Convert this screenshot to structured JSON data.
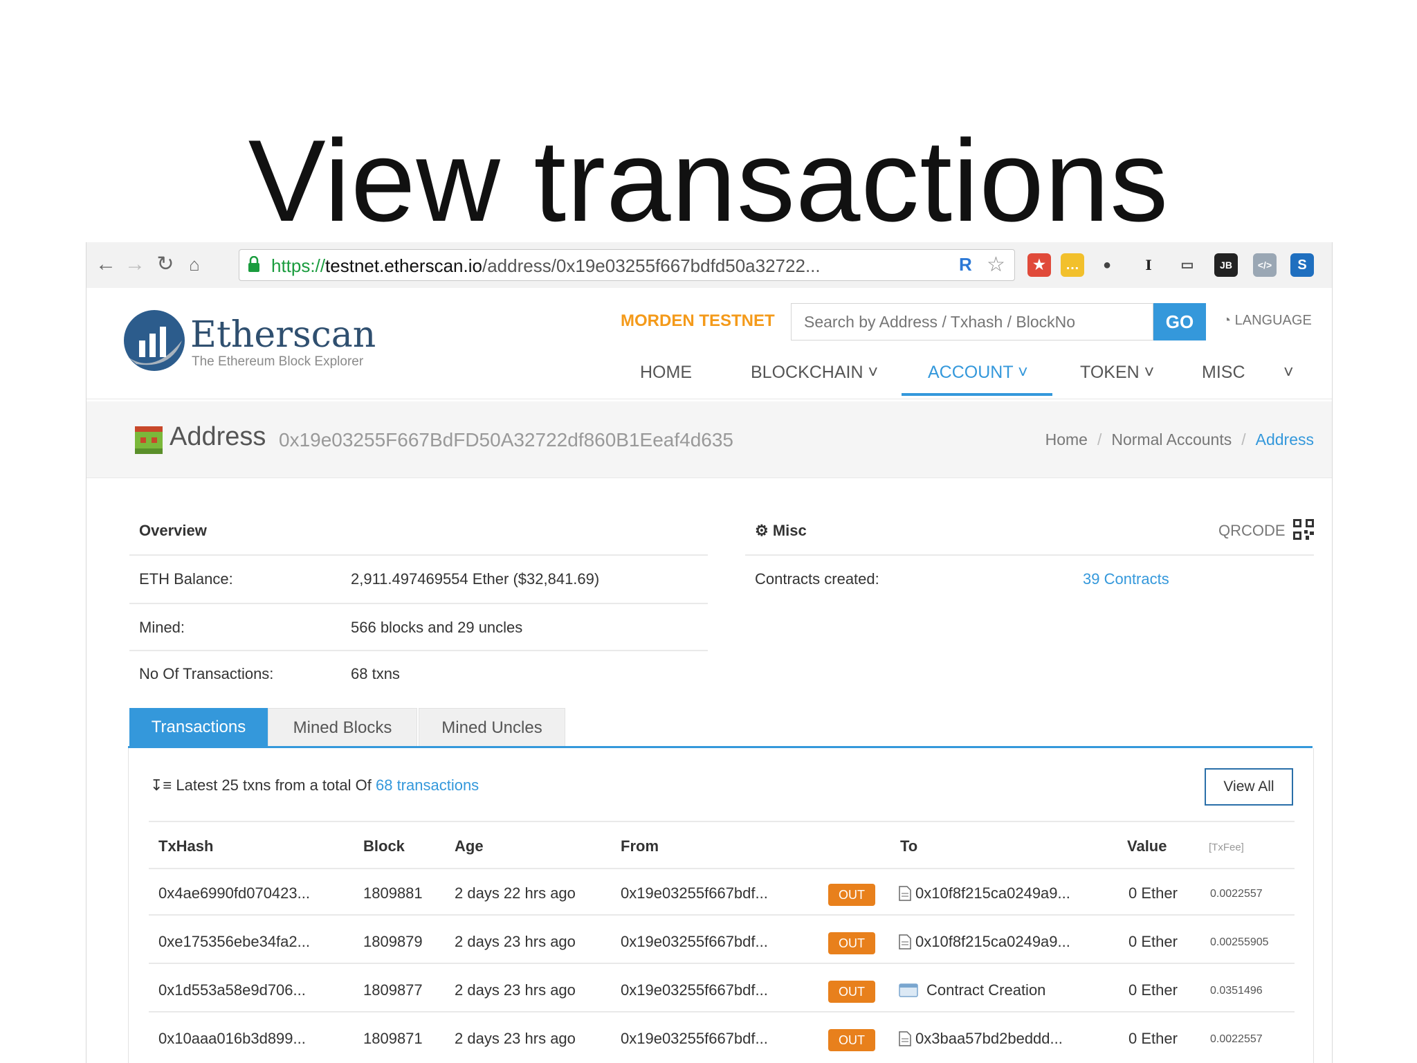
{
  "slide": {
    "title": "View transactions"
  },
  "browser": {
    "url_scheme": "https://",
    "url_host": "testnet.etherscan.io",
    "url_path": "/address/0x19e03255f667bdfd50a32722..."
  },
  "header": {
    "brand": "Etherscan",
    "tagline": "The Ethereum Block Explorer",
    "network": "MORDEN TESTNET",
    "search_placeholder": "Search by Address / Txhash / BlockNo",
    "go_label": "GO",
    "language_label": "LANGUAGE",
    "menu": [
      {
        "label": "HOME"
      },
      {
        "label": "BLOCKCHAIN ˅"
      },
      {
        "label": "ACCOUNT ˅"
      },
      {
        "label": "TOKEN ˅"
      },
      {
        "label": "MISC"
      },
      {
        "label": "˅"
      }
    ]
  },
  "address_bar": {
    "label": "Address",
    "value": "0x19e03255F667BdFD50A32722df860B1Eeaf4d635",
    "breadcrumb": [
      "Home",
      "Normal Accounts",
      "Address"
    ]
  },
  "overview": {
    "title": "Overview",
    "rows": [
      {
        "label": "ETH Balance:",
        "value": "2,911.497469554 Ether ($32,841.69)"
      },
      {
        "label": "Mined:",
        "value": "566 blocks and 29 uncles"
      },
      {
        "label": "No Of Transactions:",
        "value": "68 txns"
      }
    ]
  },
  "misc": {
    "title": "Misc",
    "qrcode_label": "QRCODE",
    "contracts_label": "Contracts created:",
    "contracts_value": "39 Contracts"
  },
  "tabs": [
    {
      "label": "Transactions",
      "active": true
    },
    {
      "label": "Mined Blocks",
      "active": false
    },
    {
      "label": "Mined Uncles",
      "active": false
    }
  ],
  "txlist": {
    "summary_prefix": "Latest 25 txns from a total Of",
    "summary_link": "68 transactions",
    "view_all": "View All",
    "columns": [
      "TxHash",
      "Block",
      "Age",
      "From",
      "To",
      "Value",
      "[TxFee]"
    ],
    "rows": [
      {
        "hash": "0x4ae6990fd070423...",
        "block": "1809881",
        "age": "2 days 22 hrs ago",
        "from": "0x19e03255f667bdf...",
        "dir": "OUT",
        "to": "0x10f8f215ca0249a9...",
        "to_type": "contract",
        "value": "0 Ether",
        "fee": "0.0022557"
      },
      {
        "hash": "0xe175356ebe34fa2...",
        "block": "1809879",
        "age": "2 days 23 hrs ago",
        "from": "0x19e03255f667bdf...",
        "dir": "OUT",
        "to": "0x10f8f215ca0249a9...",
        "to_type": "contract",
        "value": "0 Ether",
        "fee": "0.00255905"
      },
      {
        "hash": "0x1d553a58e9d706...",
        "block": "1809877",
        "age": "2 days 23 hrs ago",
        "from": "0x19e03255f667bdf...",
        "dir": "OUT",
        "to": "Contract Creation",
        "to_type": "creation",
        "value": "0 Ether",
        "fee": "0.0351496"
      },
      {
        "hash": "0x10aaa016b3d899...",
        "block": "1809871",
        "age": "2 days 23 hrs ago",
        "from": "0x19e03255f667bdf...",
        "dir": "OUT",
        "to": "0x3baa57bd2beddd...",
        "to_type": "contract",
        "value": "0 Ether",
        "fee": "0.0022557"
      }
    ]
  },
  "colors": {
    "accent": "#3498db",
    "testnet": "#f49a1a",
    "out_badge": "#e8801c",
    "link_green": "#1a9c3e"
  }
}
